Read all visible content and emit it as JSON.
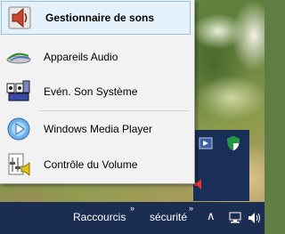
{
  "menu": {
    "items": [
      {
        "label": "Gestionnaire de sons",
        "icon": "speaker-icon",
        "selected": true
      },
      {
        "label": "Appareils Audio",
        "icon": "audio-device-icon"
      },
      {
        "label": "Evén. Son Système",
        "icon": "system-sounds-icon"
      },
      {
        "label": "Windows Media Player",
        "icon": "media-player-icon"
      },
      {
        "label": "Contrôle du Volume",
        "icon": "volume-control-icon"
      }
    ]
  },
  "taskbar": {
    "toolbar1": "Raccourcis",
    "toolbar2": "sécurité",
    "chevron": "»",
    "up_arrow": "∧"
  },
  "colors": {
    "taskbar": "#1c2d52",
    "menu_bg": "#f2f2f2",
    "selection_bg": "#e5f1fb",
    "selection_border": "#8fc2ec"
  }
}
